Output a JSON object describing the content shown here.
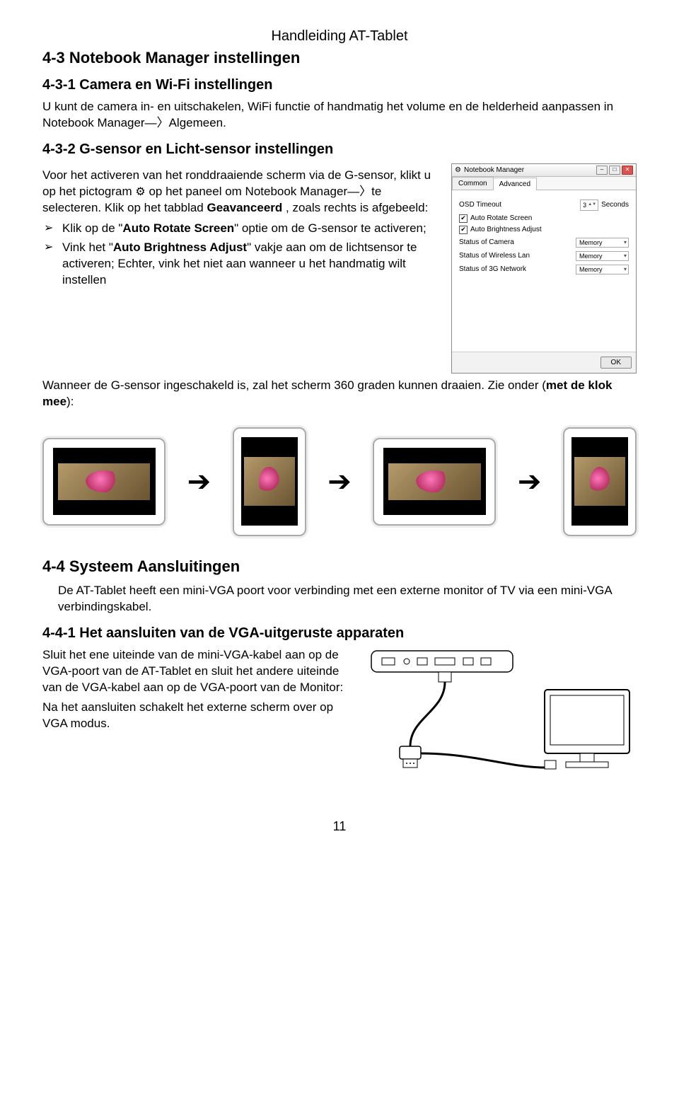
{
  "header": {
    "title": "Handleiding AT-Tablet"
  },
  "sect43": {
    "title": "4-3 Notebook Manager instellingen",
    "sub1": {
      "title": "4-3-1 Camera en Wi-Fi instellingen",
      "para": "U kunt de camera in- en uitschakelen, WiFi functie of handmatig het volume en de helderheid aanpassen in Notebook Manager―〉Algemeen."
    },
    "sub2": {
      "title": "4-3-2 G-sensor en Licht-sensor instellingen",
      "para1a": "Voor het activeren van het ronddraaiende scherm via de G-sensor, klikt u op het pictogram ",
      "para1b": " op het paneel om Notebook Manager―〉te selecteren. Klik op het tabblad ",
      "adv_word": "Geavanceerd",
      "para1c": ", zoals rechts is afgebeeld:",
      "li1a": "Klik op de \"",
      "li1_term": "Auto Rotate Screen",
      "li1b": "\" optie om de G-sensor te activeren;",
      "li2a": "Vink het \"",
      "li2_term": "Auto Brightness  Adjust",
      "li2b": "\" vakje aan om de lichtsensor te activeren; Echter, vink het niet aan wanneer u het handmatig wilt instellen",
      "para2a": "Wanneer de G-sensor ingeschakeld is, zal het scherm 360 graden kunnen draaien. Zie onder (",
      "para2_bold": "met de klok mee",
      "para2b": "):"
    }
  },
  "nm_window": {
    "title": "Notebook Manager",
    "tab_common": "Common",
    "tab_advanced": "Advanced",
    "osd_label": "OSD Timeout",
    "osd_value": "3",
    "osd_unit": "Seconds",
    "chk_rotate": "Auto Rotate Screen",
    "chk_brightness": "Auto Brightness Adjust",
    "row_camera": "Status of Camera",
    "row_wlan": "Status of Wireless Lan",
    "row_3g": "Status of 3G Network",
    "memory": "Memory",
    "ok": "OK"
  },
  "sect44": {
    "title": "4-4 Systeem Aansluitingen",
    "para": "De AT-Tablet heeft een mini-VGA poort voor verbinding met een externe monitor of TV via een mini-VGA verbindingskabel.",
    "sub1": {
      "title": "4-4-1 Het aansluiten van de VGA-uitgeruste apparaten",
      "para1": "Sluit het ene uiteinde van de mini-VGA-kabel aan op de VGA-poort van de AT-Tablet en sluit het andere uiteinde van de VGA-kabel aan op de VGA-poort van de Monitor:",
      "para2": "Na het aansluiten schakelt het externe scherm over op VGA modus."
    }
  },
  "page_number": "11"
}
